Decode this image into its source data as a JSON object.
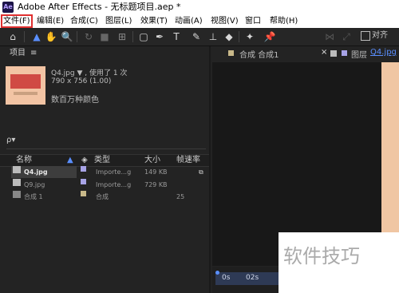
{
  "window": {
    "title": "Adobe After Effects - 无标题项目.aep *",
    "app_badge": "Ae"
  },
  "menu": [
    "文件(F)",
    "编辑(E)",
    "合成(C)",
    "图层(L)",
    "效果(T)",
    "动画(A)",
    "视图(V)",
    "窗口",
    "帮助(H)"
  ],
  "toolbar": {
    "snap_label": "对齐"
  },
  "project": {
    "panel_title": "项目",
    "panel_menu": "≡",
    "selected_item": {
      "name_line": "Q4.jpg ▼ , 使用了 1 次",
      "dimensions": "790 x 756 (1.00)",
      "color_info": "数百万种颜色"
    },
    "search_placeholder": "ρ▾",
    "columns": {
      "name": "名称",
      "type": "类型",
      "size": "大小",
      "fps": "帧速率"
    },
    "rows": [
      {
        "name": "Q4.jpg",
        "type": "Importe...g",
        "size": "149 KB",
        "fps": "",
        "swatch": "#a7a3e6"
      },
      {
        "name": "Q9.jpg",
        "type": "Importe...g",
        "size": "729 KB",
        "fps": "",
        "swatch": "#a7a3e6"
      },
      {
        "name": "合成 1",
        "type": "合成",
        "size": "",
        "fps": "25",
        "swatch": "#c9b98a"
      }
    ]
  },
  "composition": {
    "tab_comp": "合成 合成1",
    "tab_layer_prefix": "图层",
    "tab_layer_name": "Q4.jpg",
    "close_glyph": "×"
  },
  "timeline": {
    "t0": "0s",
    "t1": "02s"
  },
  "watermark": "软件技巧"
}
